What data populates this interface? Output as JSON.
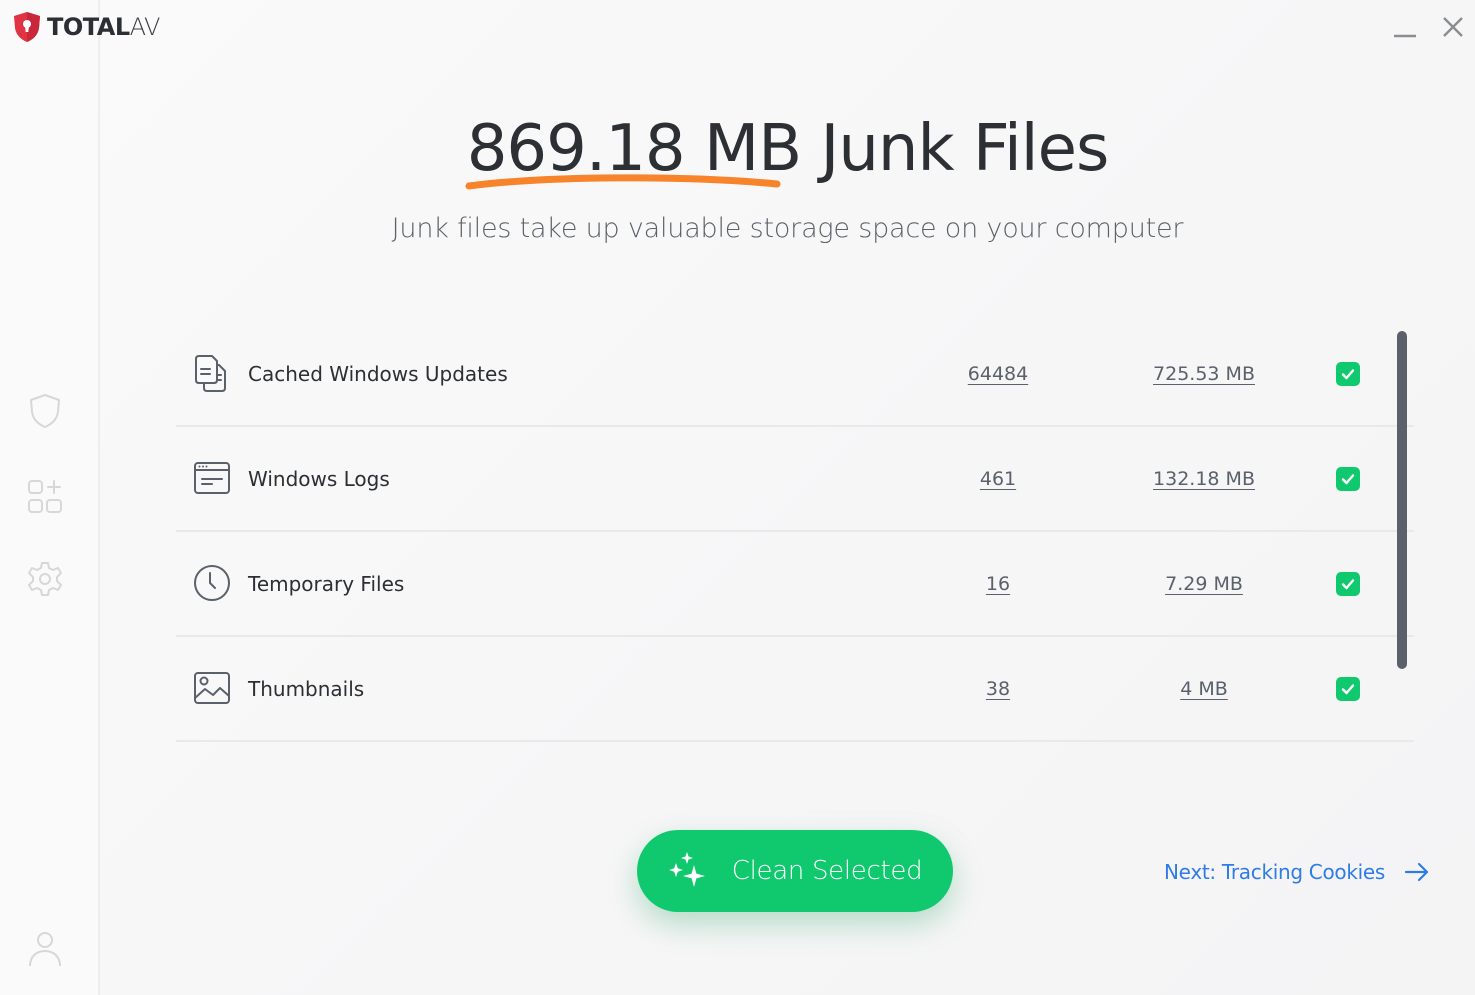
{
  "app": {
    "brand_bold": "TOTAL",
    "brand_light": "AV"
  },
  "window": {
    "minimize_label": "Minimize",
    "close_label": "Close"
  },
  "sidebar": {
    "items": [
      {
        "icon": "shield-icon",
        "label": "Protection"
      },
      {
        "icon": "apps-add-icon",
        "label": "Apps"
      },
      {
        "icon": "gear-icon",
        "label": "Settings"
      }
    ],
    "account": {
      "icon": "user-icon",
      "label": "Account"
    }
  },
  "header": {
    "amount": "869.18 MB",
    "title_rest": " Junk Files",
    "subtitle": "Junk files take up valuable storage space on your computer"
  },
  "colors": {
    "accent_green": "#10c96e",
    "underline_orange": "#f7842a",
    "link_blue": "#2f7be8",
    "logo_red": "#e03444"
  },
  "junk_items": [
    {
      "icon": "documents-icon",
      "name": "Cached Windows Updates",
      "count": "64484",
      "size": "725.53 MB",
      "checked": true
    },
    {
      "icon": "log-window-icon",
      "name": "Windows Logs",
      "count": "461",
      "size": "132.18 MB",
      "checked": true
    },
    {
      "icon": "clock-icon",
      "name": "Temporary Files",
      "count": "16",
      "size": "7.29 MB",
      "checked": true
    },
    {
      "icon": "image-icon",
      "name": "Thumbnails",
      "count": "38",
      "size": "4 MB",
      "checked": true
    }
  ],
  "actions": {
    "clean_label": "Clean Selected",
    "next_label": "Next: Tracking Cookies"
  }
}
